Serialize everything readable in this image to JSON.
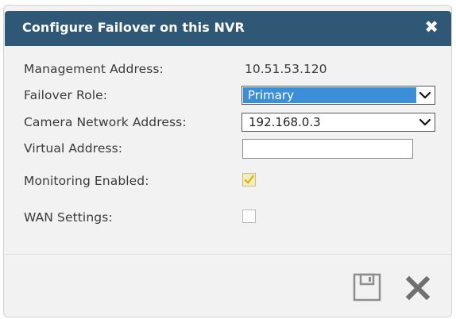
{
  "dialog": {
    "title": "Configure Failover on this NVR",
    "close_icon": "close-icon"
  },
  "fields": {
    "management_address_label": "Management Address:",
    "management_address_value": "10.51.53.120",
    "failover_role_label": "Failover Role:",
    "failover_role_value": "Primary",
    "camera_network_address_label": "Camera Network Address:",
    "camera_network_address_value": "192.168.0.3",
    "virtual_address_label": "Virtual Address:",
    "virtual_address_value": "",
    "monitoring_enabled_label": "Monitoring Enabled:",
    "monitoring_enabled_checked": true,
    "wan_settings_label": "WAN Settings:",
    "wan_settings_checked": false
  },
  "footer": {
    "save_icon": "save-icon",
    "cancel_icon": "cancel-icon"
  },
  "colors": {
    "title_bar": "#2f5876",
    "selected_option_highlight": "#3c8fd6",
    "checkbox_checked": "#f4ecc1",
    "checkmark": "#e0b200"
  }
}
